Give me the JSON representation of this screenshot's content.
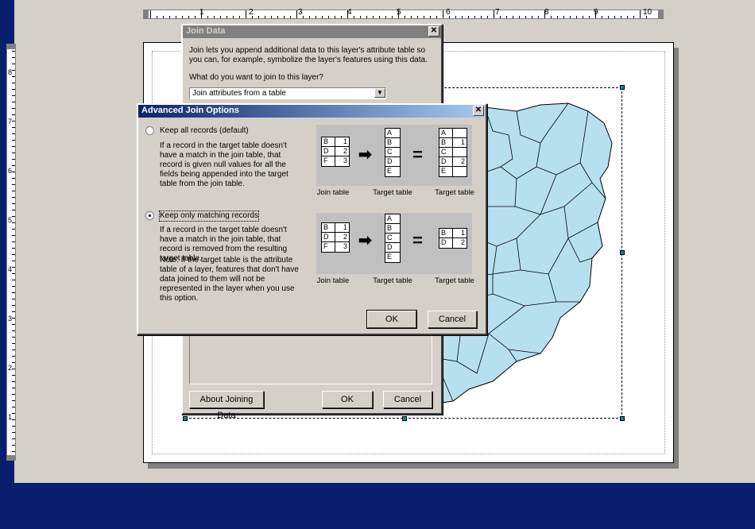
{
  "ruler": {
    "h_labels": [
      "1",
      "2",
      "3",
      "4",
      "5",
      "6",
      "7",
      "8",
      "9",
      "10"
    ],
    "v_labels": [
      "8",
      "7",
      "6",
      "5",
      "4",
      "3",
      "2",
      "1"
    ]
  },
  "join_dialog": {
    "title": "Join Data",
    "intro": "Join lets you append additional data to this layer's attribute table so you can, for example, symbolize the layer's features using this data.",
    "question": "What do you want to join to this layer?",
    "selection": "Join attributes from a table",
    "about_button": "About Joining Data",
    "ok_button": "OK",
    "cancel_button": "Cancel"
  },
  "adv_dialog": {
    "title": "Advanced Join Options",
    "option1": {
      "label": "Keep all records (default)",
      "selected": false,
      "description": "If a record in the target table doesn't have a match in the join table, that record is given null values for all the fields being appended into the target table from the join table."
    },
    "option2": {
      "label": "Keep only matching records",
      "selected": true,
      "description": "If a record in the target table doesn't have a match in the join table, that record is removed from the resulting target table.",
      "note": "Note: If the target table is the attribute table of a layer, features that don't have data joined to them will not be represented in the layer when you use this option."
    },
    "captions": {
      "join": "Join table",
      "target": "Target table",
      "result": "Target table"
    },
    "join_table": [
      [
        "B",
        "1"
      ],
      [
        "D",
        "2"
      ],
      [
        "F",
        "3"
      ]
    ],
    "target_table": [
      "A",
      "B",
      "C",
      "D",
      "E"
    ],
    "result1": [
      [
        "A",
        ""
      ],
      [
        "B",
        "1"
      ],
      [
        "C",
        ""
      ],
      [
        "D",
        "2"
      ],
      [
        "E",
        ""
      ]
    ],
    "result2": [
      [
        "B",
        "1"
      ],
      [
        "D",
        "2"
      ]
    ],
    "ok_button": "OK",
    "cancel_button": "Cancel",
    "close_icon": "close-icon"
  }
}
